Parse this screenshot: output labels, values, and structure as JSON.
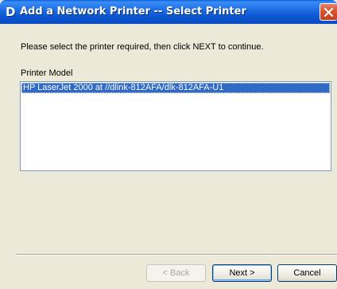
{
  "window": {
    "title": "Add a Network Printer -- Select Printer",
    "title_icon": "D"
  },
  "main": {
    "instruction": "Please select the printer required, then click NEXT to continue.",
    "printer_model_label": "Printer Model",
    "printers": [
      {
        "label": "HP LaserJet 2000 at //dlink-812AFA/dlk-812AFA-U1",
        "selected": true
      }
    ]
  },
  "buttons": {
    "back_label": "< Back",
    "next_label": "Next >",
    "cancel_label": "Cancel"
  },
  "colors": {
    "titlebar": "#0b56d0",
    "selection": "#316ac5",
    "dialog_bg": "#ece9d8",
    "close": "#d8532e"
  }
}
